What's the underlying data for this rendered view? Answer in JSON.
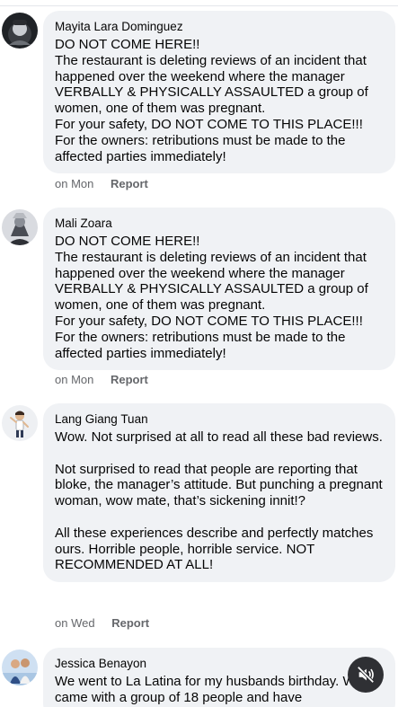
{
  "comments": [
    {
      "author": "Mayita Lara Dominguez",
      "text": "DO NOT COME HERE!!\nThe restaurant is deleting reviews of an incident that happened over the weekend where the manager VERBALLY & PHYSICALLY ASSAULTED a group of women, one of them was pregnant.\nFor your safety, DO NOT COME TO THIS PLACE!!!\nFor the owners: retributions must be made to the affected parties immediately!",
      "time": "on Mon",
      "report": "Report"
    },
    {
      "author": "Mali Zoara",
      "text": "DO NOT COME HERE!!\nThe restaurant is deleting reviews of an incident that happened over the weekend where the manager VERBALLY & PHYSICALLY ASSAULTED a group of women, one of them was pregnant.\nFor your safety, DO NOT COME TO THIS PLACE!!!\nFor the owners: retributions must be made to the affected parties immediately!",
      "time": "on Mon",
      "report": "Report"
    },
    {
      "author": "Lang Giang Tuan",
      "text": "Wow. Not surprised at all to read all these bad reviews.\n\nNot surprised to read that people are reporting that bloke, the manager’s attitude. But punching a pregnant woman, wow mate, that’s sickening innit!?\n\nAll these experiences describe and perfectly matches ours. Horrible people, horrible service. NOT RECOMMENDED AT ALL!",
      "time": "on Wed",
      "report": "Report"
    },
    {
      "author": "Jessica Benayon",
      "text": "We went to La Latina for my husbands birthday. We came with a group of 18 people and have"
    }
  ],
  "icons": {
    "mute": "speaker-muted-icon"
  }
}
